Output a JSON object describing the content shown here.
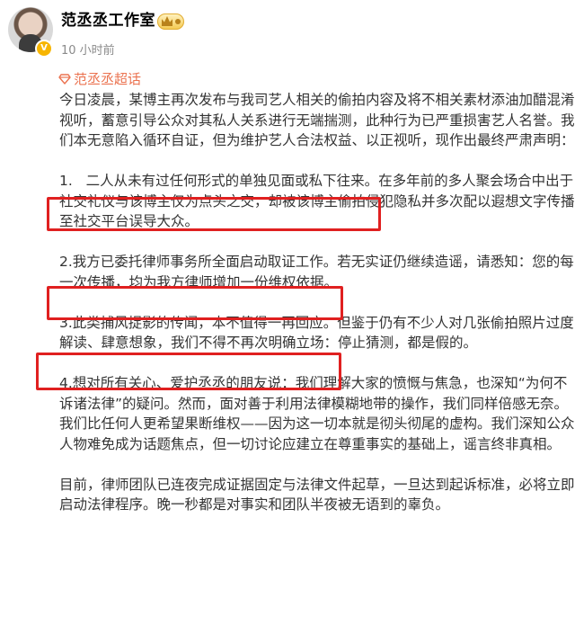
{
  "post": {
    "author_name": "范丞丞工作室",
    "time": "10 小时前",
    "topic": "范丞丞超话",
    "verified_mark": "V",
    "paragraphs": [
      "今日凌晨，某博主再次发布与我司艺人相关的偷拍内容及将不相关素材添油加醋混淆视听，蓄意引导公众对其私人关系进行无端揣测，此种行为已严重损害艺人名誉。我们本无意陷入循环自证，但为维护艺人合法权益、以正视听，现作出最终严肃声明：",
      "1.   二人从未有过任何形式的单独见面或私下往来。在多年前的多人聚会场合中出于社交礼仪与该博主仅为点头之交，却被该博主偷拍侵犯隐私并多次配以遐想文字传播至社交平台误导大众。",
      "2.我方已委托律师事务所全面启动取证工作。若无实证仍继续造谣，请悉知：您的每一次传播，均为我方律师增加一份维权依据。",
      "3.此类捕风捉影的传闻，本不值得一再回应。但鉴于仍有不少人对几张偷拍照片过度解读、肆意想象，我们不得不再次明确立场：停止猜测，都是假的。",
      "4.想对所有关心、爱护丞丞的朋友说：我们理解大家的愤慨与焦急，也深知“为何不诉诸法律”的疑问。然而，面对善于利用法律模糊地带的操作，我们同样倍感无奈。我们比任何人更希望果断维权——因为这一切本就是彻头彻尾的虚构。我们深知公众人物难免成为话题焦点，但一切讨论应建立在尊重事实的基础上，谣言终非真相。",
      "目前，律师团队已连夜完成证据固定与法律文件起草，一旦达到起诉标准，必将立即启动法律程序。晚一秒都是对事实和团队半夜被无语到的辜负。"
    ]
  },
  "colors": {
    "topic": "#eb7350",
    "highlight_box": "#e02020",
    "body_text": "#333333",
    "muted_text": "#8a8a8a"
  },
  "icons": {
    "topic": "diamond-topic-icon",
    "badge": "crown-badge-icon",
    "verified": "verified-v-icon"
  }
}
